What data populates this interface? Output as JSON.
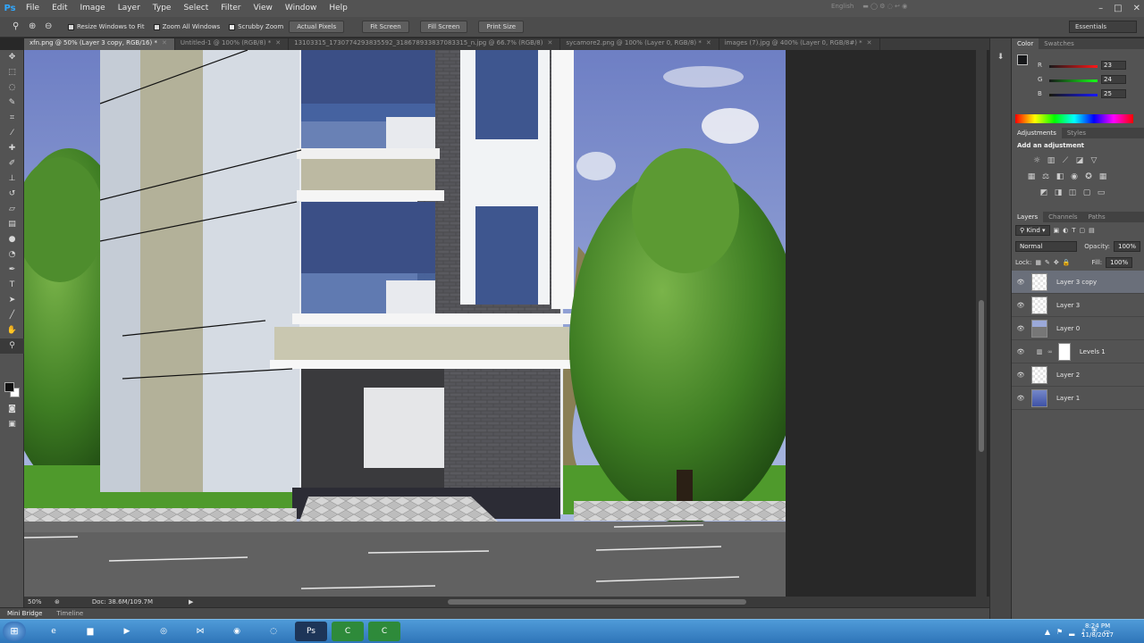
{
  "app": {
    "logo": "Ps",
    "menus": [
      "File",
      "Edit",
      "Image",
      "Layer",
      "Type",
      "Select",
      "Filter",
      "View",
      "Window",
      "Help"
    ],
    "language": "English",
    "window_controls": [
      "–",
      "□",
      "✕"
    ]
  },
  "options_bar": {
    "resize_windows_label": "Resize Windows to Fit",
    "resize_windows_checked": false,
    "zoom_all_windows_label": "Zoom All Windows",
    "zoom_all_windows_checked": false,
    "scrubby_zoom_label": "Scrubby Zoom",
    "scrubby_zoom_checked": true,
    "actual_pixels_label": "Actual Pixels",
    "fit_screen_label": "Fit Screen",
    "fill_screen_label": "Fill Screen",
    "print_size_label": "Print Size",
    "workspace": "Essentials"
  },
  "doc_tabs": [
    {
      "label": "xfn.png @ 50% (Layer 3 copy, RGB/16) *",
      "active": true
    },
    {
      "label": "Untitled-1 @ 100% (RGB/8) *",
      "active": false
    },
    {
      "label": "13103315_1730774293835592_318678933837083315_n.jpg @ 66.7% (RGB/8)",
      "active": false
    },
    {
      "label": "sycamore2.png @ 100% (Layer 0, RGB/8) *",
      "active": false
    },
    {
      "label": "images (7).jpg @ 400% (Layer 0, RGB/8#) *",
      "active": false
    }
  ],
  "status": {
    "zoom": "50%",
    "doc_size": "Doc: 38.6M/109.7M"
  },
  "bottom_panel": {
    "tabs": [
      "Mini Bridge",
      "Timeline"
    ]
  },
  "color_panel": {
    "tabs": [
      "Color",
      "Swatches"
    ],
    "r_label": "R",
    "r_value": "23",
    "g_label": "G",
    "g_value": "24",
    "b_label": "B",
    "b_value": "25",
    "foreground": "#17181a"
  },
  "adjustments_panel": {
    "tabs": [
      "Adjustments",
      "Styles"
    ],
    "title": "Add an adjustment"
  },
  "layers_panel": {
    "tabs": [
      "Layers",
      "Channels",
      "Paths"
    ],
    "filter_kind": "Kind",
    "blend_mode": "Normal",
    "opacity_label": "Opacity:",
    "opacity_value": "100%",
    "lock_label": "Lock:",
    "fill_label": "Fill:",
    "fill_value": "100%",
    "layers": [
      {
        "name": "Layer 3 copy",
        "thumb": "checker",
        "active": true
      },
      {
        "name": "Layer 3",
        "thumb": "checker",
        "active": false
      },
      {
        "name": "Layer 0",
        "thumb": "bld",
        "active": false
      },
      {
        "name": "Levels 1",
        "thumb": "levels",
        "active": false
      },
      {
        "name": "Layer 2",
        "thumb": "checker",
        "active": false
      },
      {
        "name": "Layer 1",
        "thumb": "blue",
        "active": false
      }
    ]
  },
  "taskbar": {
    "time": "8:24 PM",
    "date": "11/8/2017"
  }
}
